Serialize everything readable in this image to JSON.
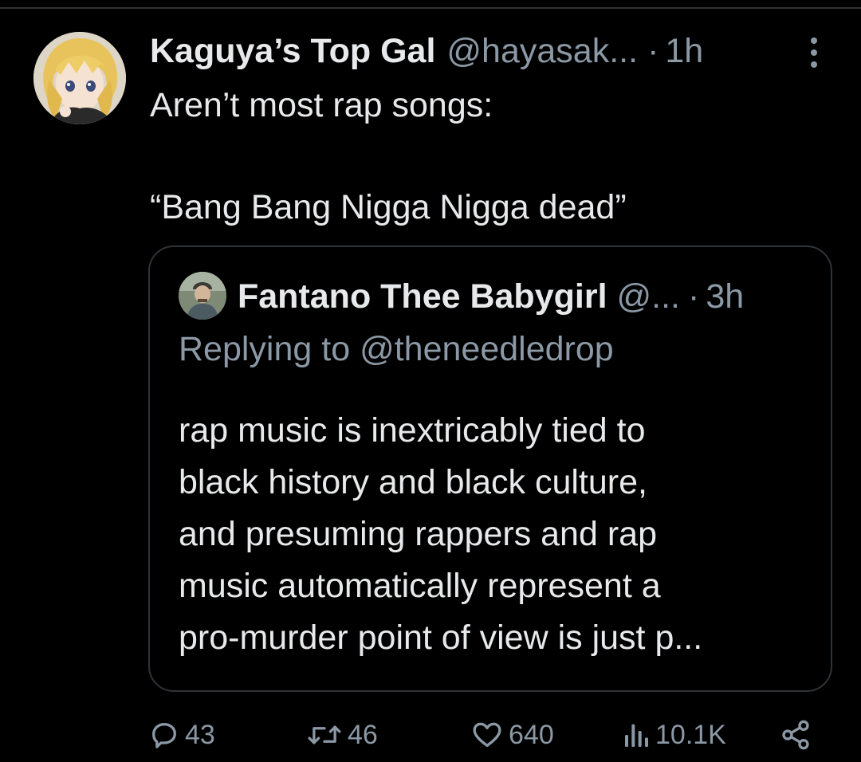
{
  "tweet": {
    "display_name": "Kaguya’s Top Gal",
    "handle": "@hayasak...",
    "separator": "·",
    "time": "1h",
    "text_lines": [
      "Aren’t most rap songs:",
      "",
      "“Bang Bang Nigga Nigga dead”"
    ]
  },
  "quote": {
    "display_name": "Fantano Thee Babygirl",
    "handle": "@...",
    "separator": "·",
    "time": "3h",
    "replying_to": "Replying to @theneedledrop",
    "body_lines": [
      "rap music is inextricably tied to",
      "black history and black culture,",
      "and presuming rappers and rap",
      "music automatically represent a",
      "pro-murder point of view is just p..."
    ]
  },
  "actions": {
    "replies": "43",
    "retweets": "46",
    "likes": "640",
    "views": "10.1K"
  },
  "colors": {
    "background": "#000000",
    "text": "#e7e9ea",
    "secondary": "#8b98a5",
    "border": "#2f3336"
  },
  "icons": [
    "more-icon",
    "reply-icon",
    "retweet-icon",
    "like-icon",
    "views-icon",
    "share-icon"
  ]
}
